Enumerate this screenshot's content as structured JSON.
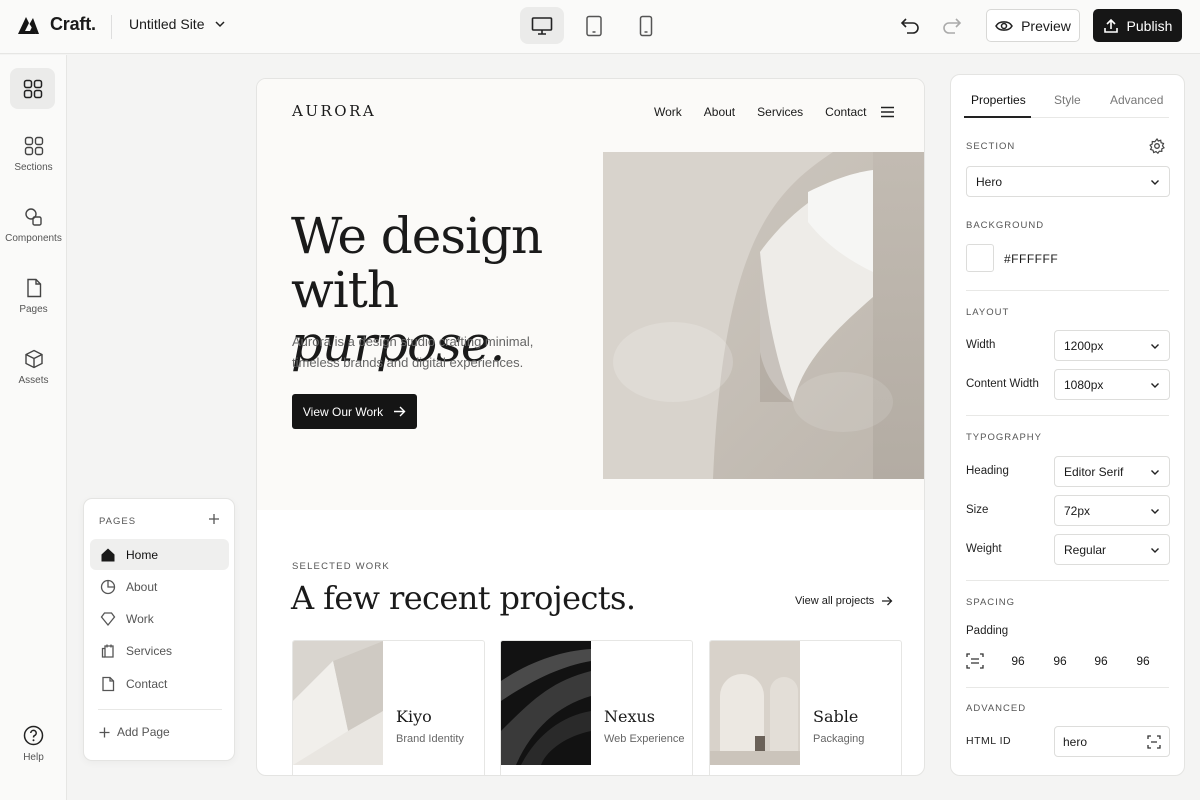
{
  "app": {
    "name": "Craft.",
    "site_title": "Untitled Site"
  },
  "toolbar": {
    "preview_label": "Preview",
    "publish_label": "Publish",
    "devices": [
      "desktop-icon",
      "tablet-icon",
      "mobile-icon"
    ],
    "active_device": "desktop"
  },
  "rail": {
    "items": [
      {
        "label": "Sections",
        "icon": "sections-icon"
      },
      {
        "label": "Components",
        "icon": "components-icon"
      },
      {
        "label": "Pages",
        "icon": "page-icon"
      },
      {
        "label": "Assets",
        "icon": "assets-icon"
      }
    ],
    "help_label": "Help"
  },
  "pages_panel": {
    "heading": "PAGES",
    "items": [
      "Home",
      "About",
      "Work",
      "Services",
      "Contact"
    ],
    "active": "Home",
    "add_label": "Add Page"
  },
  "canvas": {
    "brand": "AURORA",
    "nav": [
      "Work",
      "About",
      "Services",
      "Contact"
    ],
    "hero": {
      "line1": "We design",
      "line2a": "with ",
      "line2b": "purpose.",
      "body": "Aurora is a design studio crafting minimal, timeless brands and digital experiences.",
      "cta": "View Our Work"
    },
    "selected": {
      "label": "SELECTED WORK",
      "title": "A few recent projects.",
      "view_all": "View all projects"
    },
    "projects": [
      {
        "title": "Kiyo",
        "subtitle": "Brand Identity"
      },
      {
        "title": "Nexus",
        "subtitle": "Web Experience"
      },
      {
        "title": "Sable",
        "subtitle": "Packaging"
      }
    ]
  },
  "properties": {
    "tabs": [
      "Properties",
      "Style",
      "Advanced"
    ],
    "active_tab": "Properties",
    "section": {
      "label": "SECTION",
      "value": "Hero"
    },
    "background": {
      "label": "BACKGROUND",
      "value": "#FFFFFF"
    },
    "layout": {
      "label": "LAYOUT",
      "width_label": "Width",
      "width": "1200px",
      "content_width_label": "Content Width",
      "content_width": "1080px"
    },
    "typography": {
      "label": "TYPOGRAPHY",
      "heading_label": "Heading",
      "heading": "Editor Serif",
      "size_label": "Size",
      "size": "72px",
      "weight_label": "Weight",
      "weight": "Regular"
    },
    "spacing": {
      "label": "SPACING",
      "padding_label": "Padding",
      "top": "96",
      "right": "96",
      "bottom": "96",
      "left": "96"
    },
    "advanced": {
      "label": "ADVANCED",
      "html_id_label": "HTML ID",
      "html_id": "hero"
    }
  },
  "colors": {
    "accent": "#161616",
    "canvas_bg": "#fbfaf8",
    "app_bg": "#f4f4f3"
  }
}
